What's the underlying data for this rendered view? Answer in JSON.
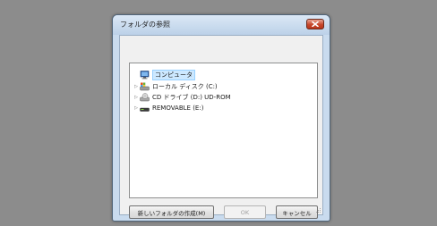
{
  "dialog": {
    "title": "フォルダの参照",
    "close_icon": "close-icon"
  },
  "tree": {
    "items": [
      {
        "label": "コンピュータ",
        "icon": "computer-icon",
        "expander": "",
        "selected": true
      },
      {
        "label": "ローカル ディスク (C:)",
        "icon": "local-disk-icon",
        "expander": "▷"
      },
      {
        "label": "CD ドライブ (D:) UD-ROM",
        "icon": "cd-drive-icon",
        "expander": "▷"
      },
      {
        "label": "REMOVABLE (E:)",
        "icon": "removable-drive-icon",
        "expander": "▷"
      }
    ]
  },
  "buttons": {
    "new_folder": "新しいフォルダの作成(M)",
    "ok": "OK",
    "cancel": "キャンセル"
  },
  "colors": {
    "desktop": "#8c8c8c",
    "dialog_frame": "#c9dbee",
    "close_button": "#c7472b",
    "selection": "#cce8ff"
  }
}
